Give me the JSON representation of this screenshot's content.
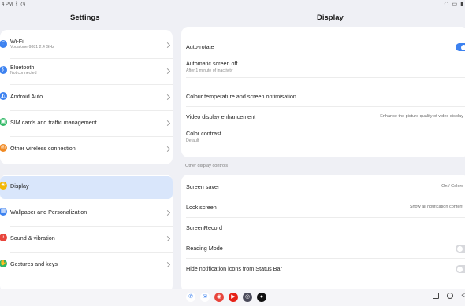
{
  "status_bar": {
    "time": "4 PM"
  },
  "left_pane": {
    "title": "Settings",
    "group1": [
      {
        "label": "Wi-Fi",
        "sub": "Vodafone-9881 2.4 GHz",
        "icon": "wifi-icon",
        "color": "#3d82f0",
        "glyph": "⌔"
      },
      {
        "label": "Bluetooth",
        "sub": "Not connected",
        "icon": "bluetooth-icon",
        "color": "#3d82f0",
        "glyph": "ᛒ"
      },
      {
        "label": "Android Auto",
        "sub": "",
        "icon": "android-auto-icon",
        "color": "#3d82f0",
        "glyph": "◭"
      },
      {
        "label": "SIM cards and traffic management",
        "sub": "",
        "icon": "sim-card-icon",
        "color": "#2fb864",
        "glyph": "▣"
      },
      {
        "label": "Other wireless connection",
        "sub": "",
        "icon": "wireless-icon",
        "color": "#f08a24",
        "glyph": "◎"
      }
    ],
    "group2": [
      {
        "label": "Display",
        "sub": "",
        "icon": "display-icon",
        "color": "#f2b705",
        "glyph": "☀",
        "selected": true
      },
      {
        "label": "Wallpaper and Personalization",
        "sub": "",
        "icon": "wallpaper-icon",
        "color": "#3d82f0",
        "glyph": "▦"
      },
      {
        "label": "Sound & vibration",
        "sub": "",
        "icon": "sound-icon",
        "color": "#e8453c",
        "glyph": "♪"
      },
      {
        "label": "Gestures and keys",
        "sub": "",
        "icon": "gestures-icon",
        "color": "#2fb864",
        "glyph": "✋"
      }
    ]
  },
  "right_pane": {
    "title": "Display",
    "group1": [
      {
        "label": "Auto-rotate",
        "toggle": "on"
      },
      {
        "label": "Automatic screen off",
        "sub": "After 1 minute of inactivity"
      },
      {
        "label": "Colour temperature and screen optimisation"
      },
      {
        "label": "Video display enhancement",
        "value": "Enhance the picture quality of video display"
      },
      {
        "label": "Color contrast",
        "sub": "Default"
      }
    ],
    "section_label": "Other display controls",
    "group2": [
      {
        "label": "Screen saver",
        "value": "On / Colors"
      },
      {
        "label": "Lock screen",
        "value": "Show all notification content"
      },
      {
        "label": "ScreenRecord"
      },
      {
        "label": "Reading Mode",
        "toggle": "off"
      },
      {
        "label": "Hide notification icons from Status Bar",
        "toggle": "off"
      }
    ]
  },
  "dock_apps": [
    {
      "name": "phone-app-icon",
      "color": "#ffffff",
      "fg": "#3d82f0",
      "glyph": "✆"
    },
    {
      "name": "messages-app-icon",
      "color": "#ffffff",
      "fg": "#3d82f0",
      "glyph": "✉"
    },
    {
      "name": "chrome-app-icon",
      "color": "#e8453c",
      "fg": "#ffffff",
      "glyph": "◉"
    },
    {
      "name": "youtube-app-icon",
      "color": "#e62117",
      "fg": "#ffffff",
      "glyph": "▶"
    },
    {
      "name": "camera-app-icon",
      "color": "#4a4a5a",
      "fg": "#ffffff",
      "glyph": "◎"
    },
    {
      "name": "music-app-icon",
      "color": "#111111",
      "fg": "#ffffff",
      "glyph": "●"
    }
  ]
}
